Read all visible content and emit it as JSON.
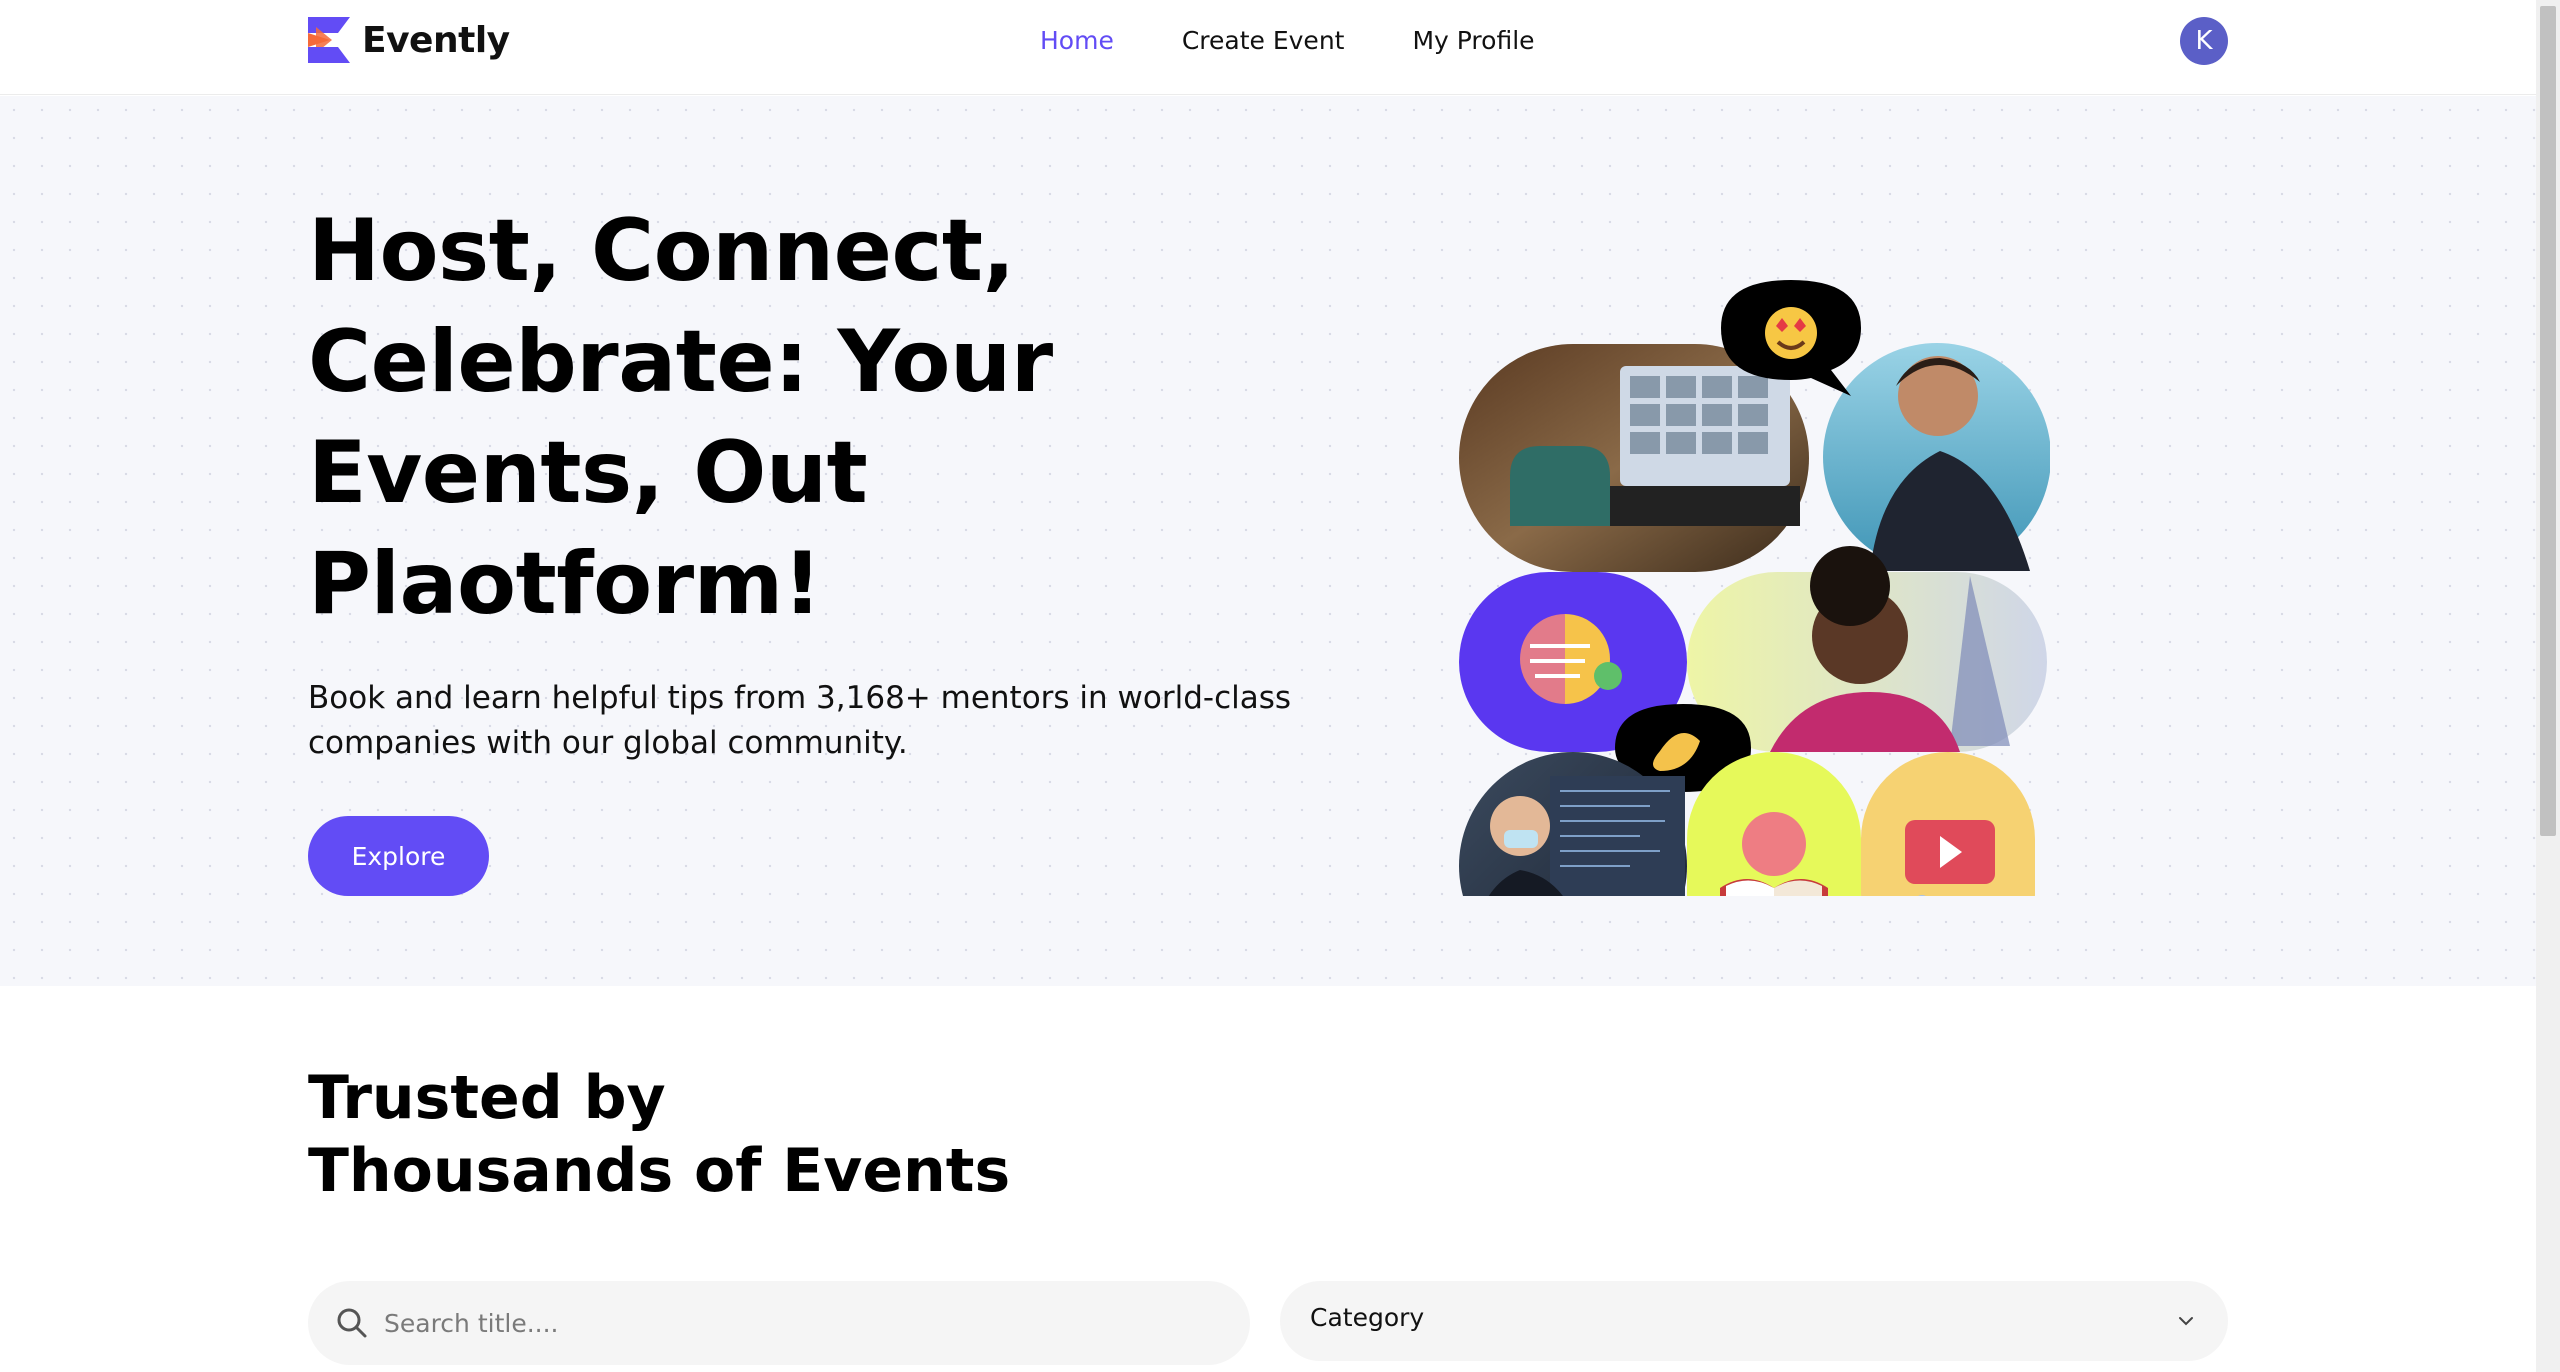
{
  "app": {
    "name": "Evently"
  },
  "nav": {
    "items": [
      {
        "label": "Home",
        "active": true
      },
      {
        "label": "Create Event",
        "active": false
      },
      {
        "label": "My Profile",
        "active": false
      }
    ]
  },
  "user": {
    "avatar_initial": "K"
  },
  "hero": {
    "title": "Host, Connect, Celebrate: Your Events, Out Plaotform!",
    "subtitle": "Book and learn helpful tips from 3,168+ mentors in world-class companies with our global community.",
    "cta_label": "Explore"
  },
  "section": {
    "title_line1": "Trusted by",
    "title_line2": "Thousands of Events"
  },
  "search": {
    "placeholder": "Search title...."
  },
  "category": {
    "label": "Category"
  },
  "colors": {
    "accent": "#624cf5",
    "avatar": "#5b5fc7",
    "hero_bg": "#f6f7fb",
    "input_bg": "#f5f5f5",
    "logo_orange": "#f56a3a"
  },
  "icons": {
    "logo": "evently-logo-icon",
    "search": "search-icon",
    "dropdown": "chevron-down-icon"
  }
}
